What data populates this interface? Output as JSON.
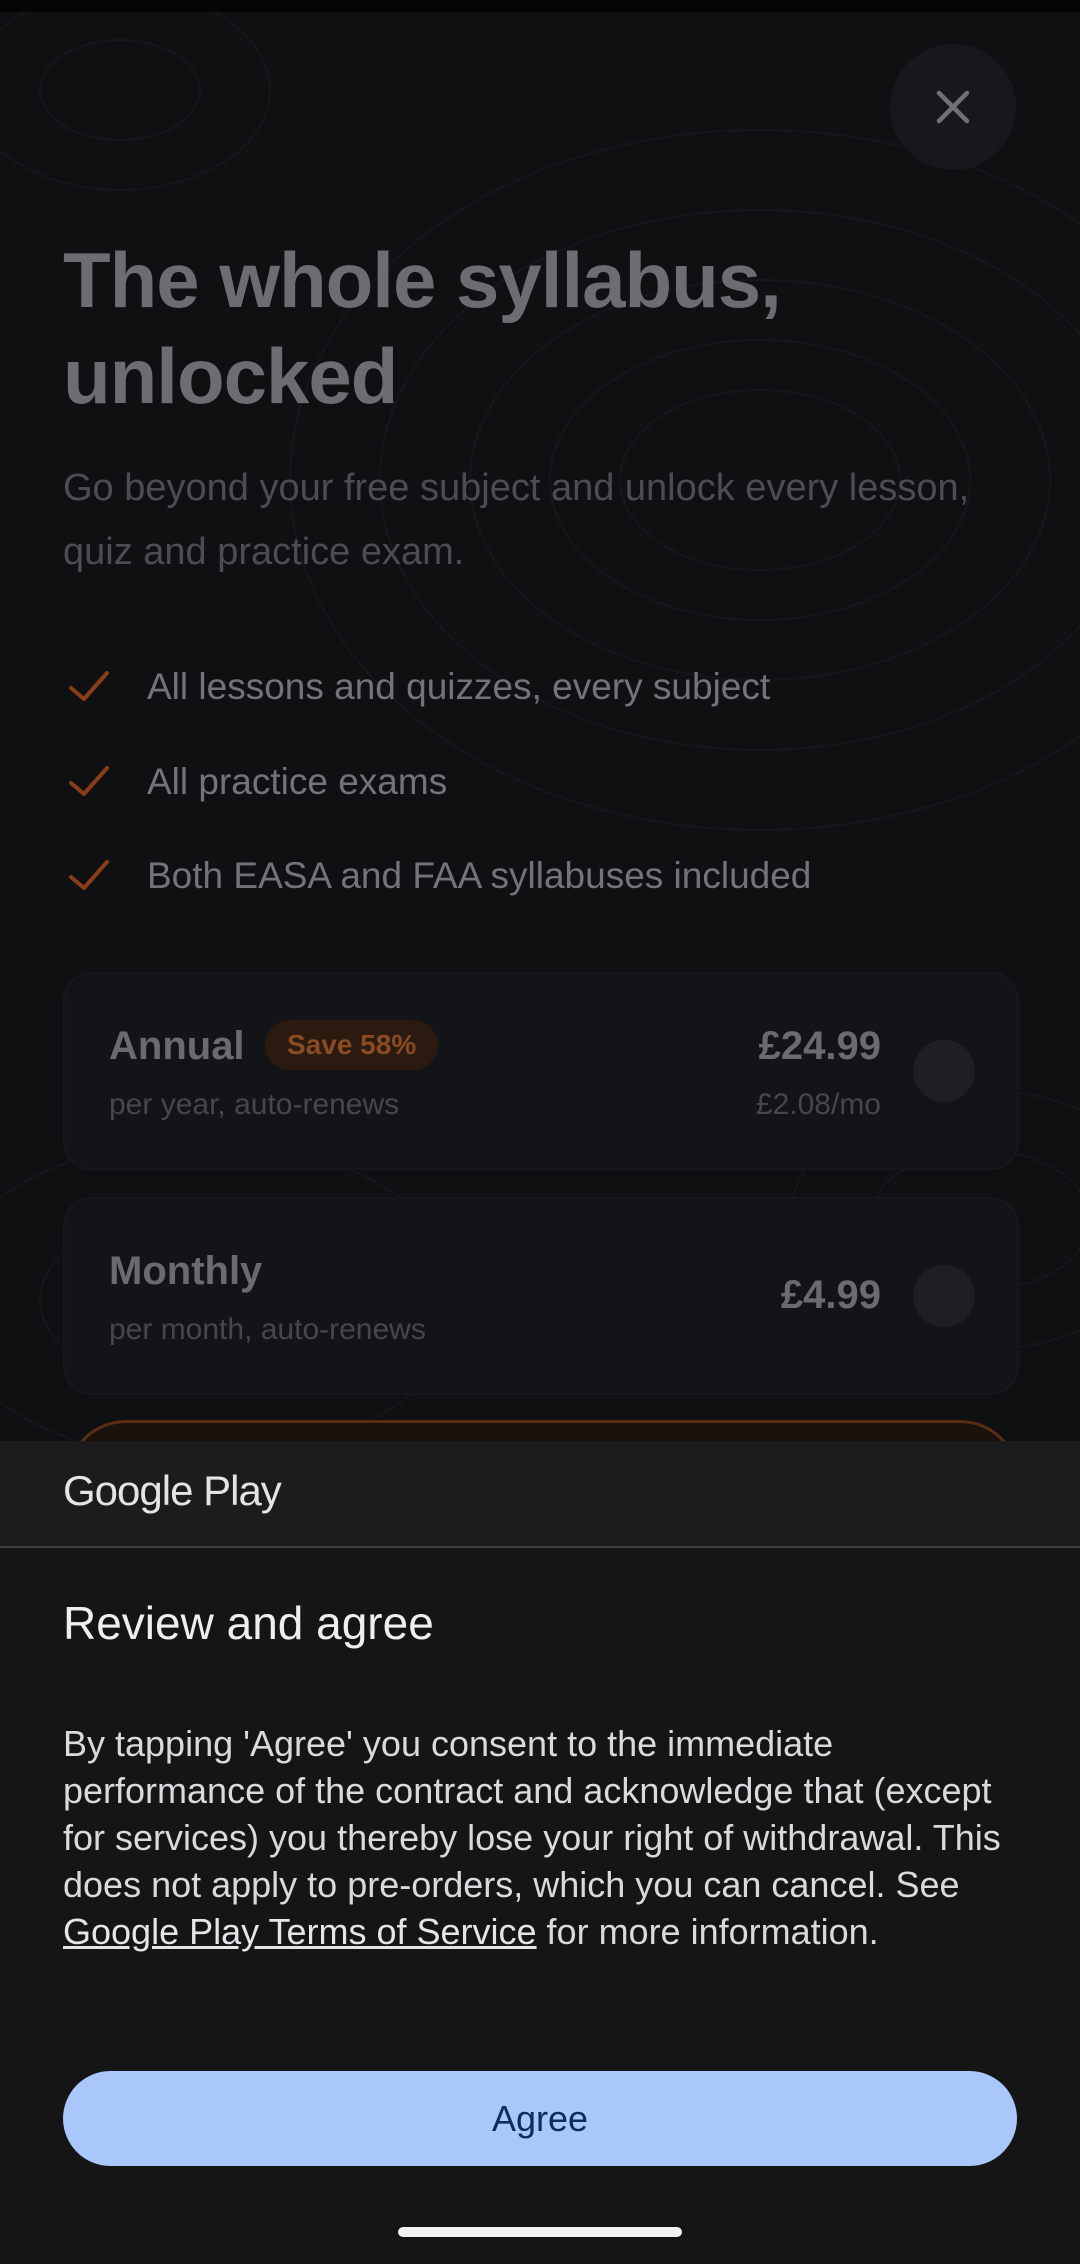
{
  "paywall": {
    "headline_line1": "The whole syllabus,",
    "headline_line2": "unlocked",
    "subhead": "Go beyond your free subject and unlock every lesson, quiz and practice exam.",
    "close_icon": "close-icon",
    "features": [
      {
        "icon": "check-icon",
        "text": "All lessons and quizzes, every subject"
      },
      {
        "icon": "check-icon",
        "text": "All practice exams"
      },
      {
        "icon": "check-icon",
        "text": "Both EASA and FAA syllabuses included"
      }
    ],
    "plans": {
      "annual": {
        "name": "Annual",
        "badge": "Save 58%",
        "subtitle": "per year, auto-renews",
        "price": "£24.99",
        "per_month": "£2.08/mo"
      },
      "monthly": {
        "name": "Monthly",
        "subtitle": "per month, auto-renews",
        "price": "£4.99"
      }
    },
    "accent_color": "#c4571e"
  },
  "sheet": {
    "brand": "Google Play",
    "title": "Review and agree",
    "consent_before": "By tapping 'Agree' you consent to the immediate performance of the contract and acknowledge that (except for services) you thereby lose your right of withdrawal. This does not apply to pre-orders, which you can cancel. See ",
    "consent_link": "Google Play Terms of Service",
    "consent_after": " for more information.",
    "agree_label": "Agree",
    "button_color": "#a9c7fa"
  }
}
